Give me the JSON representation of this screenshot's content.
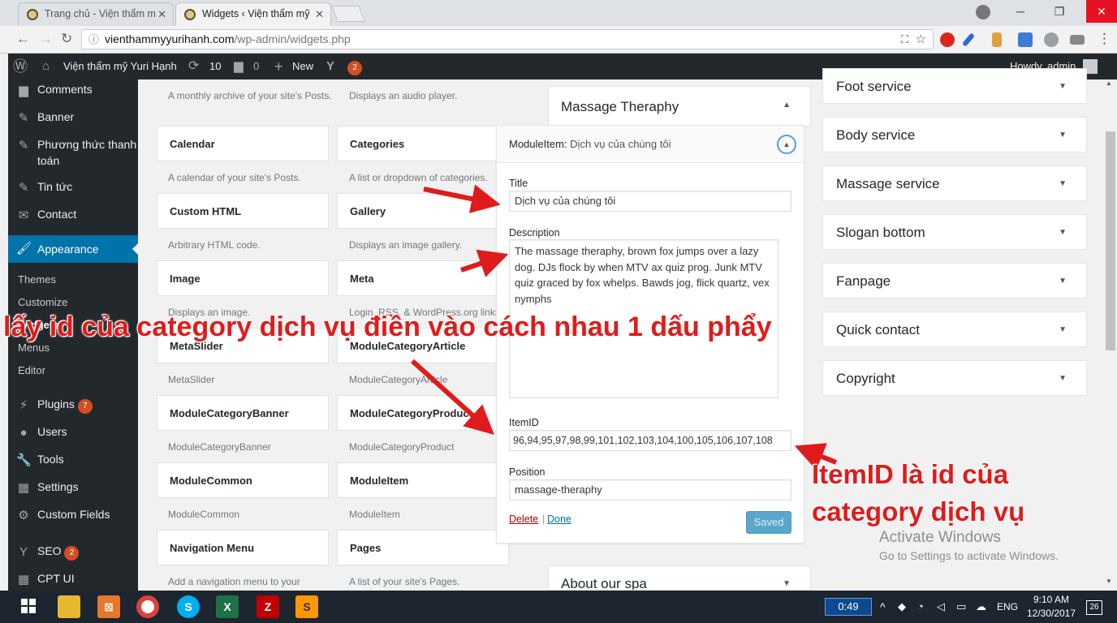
{
  "browser": {
    "tabs": [
      {
        "title": "Trang chủ - Viện thẩm m",
        "active": false
      },
      {
        "title": "Widgets ‹ Viện thẩm mỹ",
        "active": true
      }
    ],
    "url_host": "vienthammyyurihanh.com",
    "url_path": "/wp-admin/widgets.php"
  },
  "adminbar": {
    "site_name": "Viện thẩm mỹ Yuri Hạnh",
    "updates_count": "10",
    "comments_count": "0",
    "new_label": "New",
    "yoast_count": "2",
    "howdy": "Howdy, admin"
  },
  "sidebar": {
    "items_top": [
      "Comments",
      "Banner",
      "Phương thức thanh toán",
      "Tin tức",
      "Contact"
    ],
    "appearance": "Appearance",
    "appearance_sub": [
      "Themes",
      "Customize",
      "Widgets",
      "Menus",
      "Editor"
    ],
    "items_bottom": [
      "Plugins",
      "Users",
      "Tools",
      "Settings",
      "Custom Fields"
    ],
    "plugins_badge": "7",
    "seo": "SEO",
    "seo_badge": "2",
    "cpt": "CPT UI"
  },
  "available_widgets": {
    "top_desc_left": "A monthly archive of your site's Posts.",
    "top_desc_right": "Displays an audio player.",
    "rows": [
      {
        "left": {
          "name": "Calendar",
          "desc": "A calendar of your site's Posts."
        },
        "right": {
          "name": "Categories",
          "desc": "A list or dropdown of categories."
        }
      },
      {
        "left": {
          "name": "Custom HTML",
          "desc": "Arbitrary HTML code."
        },
        "right": {
          "name": "Gallery",
          "desc": "Displays an image gallery."
        }
      },
      {
        "left": {
          "name": "Image",
          "desc": "Displays an image."
        },
        "right": {
          "name": "Meta",
          "desc": "Login, RSS, & WordPress.org links."
        }
      },
      {
        "left": {
          "name": "MetaSlider",
          "desc": "MetaSlider"
        },
        "right": {
          "name": "ModuleCategoryArticle",
          "desc": "ModuleCategoryArticle"
        }
      },
      {
        "left": {
          "name": "ModuleCategoryBanner",
          "desc": "ModuleCategoryBanner"
        },
        "right": {
          "name": "ModuleCategoryProduct",
          "desc": "ModuleCategoryProduct"
        }
      },
      {
        "left": {
          "name": "ModuleCommon",
          "desc": "ModuleCommon"
        },
        "right": {
          "name": "ModuleItem",
          "desc": "ModuleItem"
        }
      },
      {
        "left": {
          "name": "Navigation Menu",
          "desc": "Add a navigation menu to your"
        },
        "right": {
          "name": "Pages",
          "desc": "A list of your site's Pages."
        }
      }
    ]
  },
  "massage_sidebar": {
    "title": "Massage Theraphy",
    "widget_prefix": "ModuleItem:",
    "widget_name": "Dịch vụ của chúng tôi",
    "title_label": "Title",
    "title_value": "Dịch vụ của chúng tôi",
    "description_label": "Description",
    "description_value": "The massage theraphy, brown fox jumps over a lazy dog. DJs flock by when MTV ax quiz prog. Junk MTV quiz graced by fox whelps. Bawds jog, flick quartz, vex nymphs",
    "itemid_label": "ItemID",
    "itemid_value": "96,94,95,97,98,99,101,102,103,104,100,105,106,107,108",
    "position_label": "Position",
    "position_value": "massage-theraphy",
    "delete_label": "Delete",
    "separator": "|",
    "done_label": "Done",
    "saved_label": "Saved"
  },
  "about_sidebar": "About our spa",
  "right_sidebars": [
    "Foot service",
    "Body service",
    "Massage service",
    "Slogan bottom",
    "Fanpage",
    "Quick contact",
    "Copyright"
  ],
  "annotations": {
    "main": "lấy id của category dịch vụ điền vào cách nhau 1 dấu phẩy",
    "itemid_line1": "ItemID là id của",
    "itemid_line2": "category dịch vụ"
  },
  "watermark": {
    "line1": "Activate Windows",
    "line2": "Go to Settings to activate Windows."
  },
  "taskbar": {
    "timer": "0:49",
    "lang": "ENG",
    "time": "9:10 AM",
    "date": "12/30/2017",
    "notif": "26"
  }
}
